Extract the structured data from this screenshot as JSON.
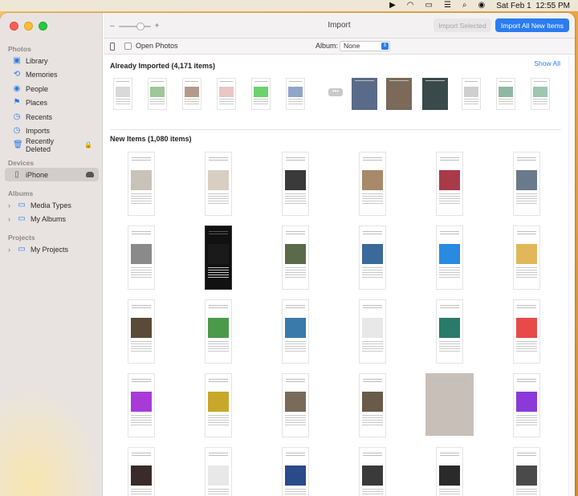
{
  "menubar": {
    "date": "Sat Feb 1",
    "time": "12:55 PM",
    "icons": [
      "play-circle-icon",
      "wifi-icon",
      "battery-icon",
      "control-center-icon",
      "spotlight-icon",
      "siri-icon"
    ]
  },
  "sidebar": {
    "sections": {
      "photos": "Photos",
      "devices": "Devices",
      "albums": "Albums",
      "projects": "Projects"
    },
    "items": [
      {
        "label": "Library",
        "icon": "library-icon"
      },
      {
        "label": "Memories",
        "icon": "memories-icon"
      },
      {
        "label": "People",
        "icon": "people-icon"
      },
      {
        "label": "Places",
        "icon": "places-icon"
      },
      {
        "label": "Recents",
        "icon": "recents-icon"
      },
      {
        "label": "Imports",
        "icon": "imports-icon"
      },
      {
        "label": "Recently Deleted",
        "icon": "trash-icon"
      }
    ],
    "device": "iPhone",
    "albums": [
      "Media Types",
      "My Albums"
    ],
    "projects": [
      "My Projects"
    ]
  },
  "toolbar": {
    "title": "Import",
    "import_selected": "Import Selected",
    "import_all": "Import All New Items",
    "zoom_minus": "–",
    "zoom_plus": "+",
    "zoom_level": 0.55
  },
  "options": {
    "open_photos": "Open Photos",
    "album_label": "Album:",
    "album_value": "None"
  },
  "already_imported": {
    "heading": "Already Imported (4,171 items)",
    "show_all": "Show All",
    "more": "•••"
  },
  "new_items": {
    "heading": "New Items (1,080 items)"
  },
  "colors": {
    "accent": "#2b7cf0",
    "sidebar_bg": "#e8e3e1"
  }
}
